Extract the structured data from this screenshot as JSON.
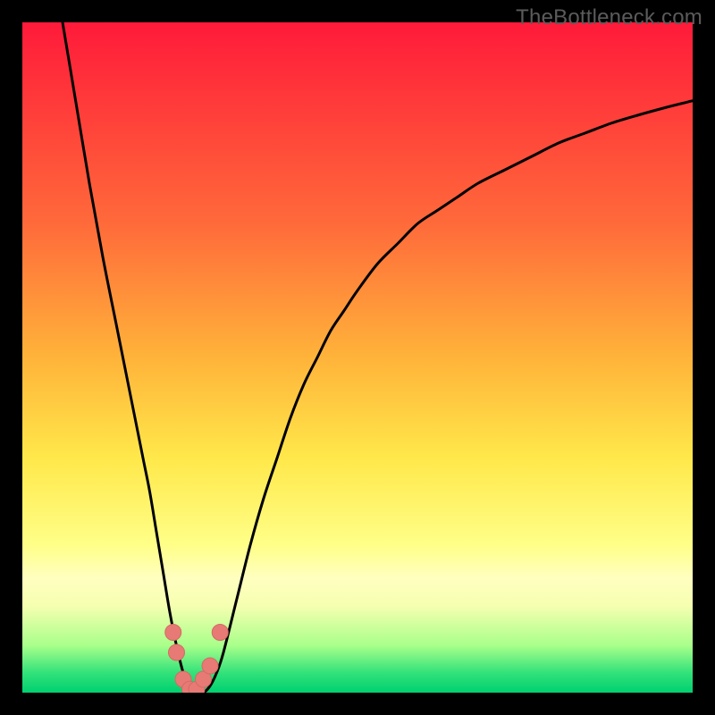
{
  "watermark": "TheBottleneck.com",
  "colors": {
    "frame": "#000000",
    "curve": "#000000",
    "marker_fill": "#e77a74",
    "marker_stroke": "#d46b65",
    "gradient_stops": [
      {
        "offset": 0.0,
        "color": "#ff1a3a"
      },
      {
        "offset": 0.12,
        "color": "#ff3a3a"
      },
      {
        "offset": 0.3,
        "color": "#ff6a3a"
      },
      {
        "offset": 0.5,
        "color": "#ffb33a"
      },
      {
        "offset": 0.65,
        "color": "#ffe84a"
      },
      {
        "offset": 0.78,
        "color": "#ffff88"
      },
      {
        "offset": 0.83,
        "color": "#ffffc0"
      },
      {
        "offset": 0.87,
        "color": "#f6ffb0"
      },
      {
        "offset": 0.93,
        "color": "#a8ff8a"
      },
      {
        "offset": 0.97,
        "color": "#33e27a"
      },
      {
        "offset": 1.0,
        "color": "#00d070"
      }
    ]
  },
  "chart_data": {
    "type": "line",
    "title": "",
    "xlabel": "",
    "ylabel": "",
    "xlim": [
      0,
      100
    ],
    "ylim": [
      0,
      100
    ],
    "x": [
      6,
      8,
      10,
      12,
      14,
      16,
      18,
      19,
      20,
      21,
      22,
      23,
      24,
      25,
      26,
      27,
      28,
      29,
      30,
      32,
      34,
      36,
      38,
      40,
      42,
      44,
      46,
      48,
      50,
      53,
      56,
      59,
      62,
      65,
      68,
      72,
      76,
      80,
      84,
      88,
      92,
      96,
      100
    ],
    "values": [
      100,
      88,
      76,
      65,
      55,
      45,
      35,
      30,
      24,
      18,
      12,
      7,
      3,
      1,
      0,
      0,
      1,
      3,
      6,
      14,
      22,
      29,
      35,
      41,
      46,
      50,
      54,
      57,
      60,
      64,
      67,
      70,
      72,
      74,
      76,
      78,
      80,
      82,
      83.5,
      85,
      86.2,
      87.3,
      88.3
    ],
    "series": [
      {
        "name": "curve",
        "x": [
          6,
          8,
          10,
          12,
          14,
          16,
          18,
          19,
          20,
          21,
          22,
          23,
          24,
          25,
          26,
          27,
          28,
          29,
          30,
          32,
          34,
          36,
          38,
          40,
          42,
          44,
          46,
          48,
          50,
          53,
          56,
          59,
          62,
          65,
          68,
          72,
          76,
          80,
          84,
          88,
          92,
          96,
          100
        ],
        "y": [
          100,
          88,
          76,
          65,
          55,
          45,
          35,
          30,
          24,
          18,
          12,
          7,
          3,
          1,
          0,
          0,
          1,
          3,
          6,
          14,
          22,
          29,
          35,
          41,
          46,
          50,
          54,
          57,
          60,
          64,
          67,
          70,
          72,
          74,
          76,
          78,
          80,
          82,
          83.5,
          85,
          86.2,
          87.3,
          88.3
        ]
      }
    ],
    "markers": [
      {
        "x": 22.5,
        "y": 9
      },
      {
        "x": 23.0,
        "y": 6
      },
      {
        "x": 24.0,
        "y": 2
      },
      {
        "x": 25.0,
        "y": 0.5
      },
      {
        "x": 26.0,
        "y": 0.5
      },
      {
        "x": 27.0,
        "y": 2
      },
      {
        "x": 28.0,
        "y": 4
      },
      {
        "x": 29.5,
        "y": 9
      }
    ]
  }
}
